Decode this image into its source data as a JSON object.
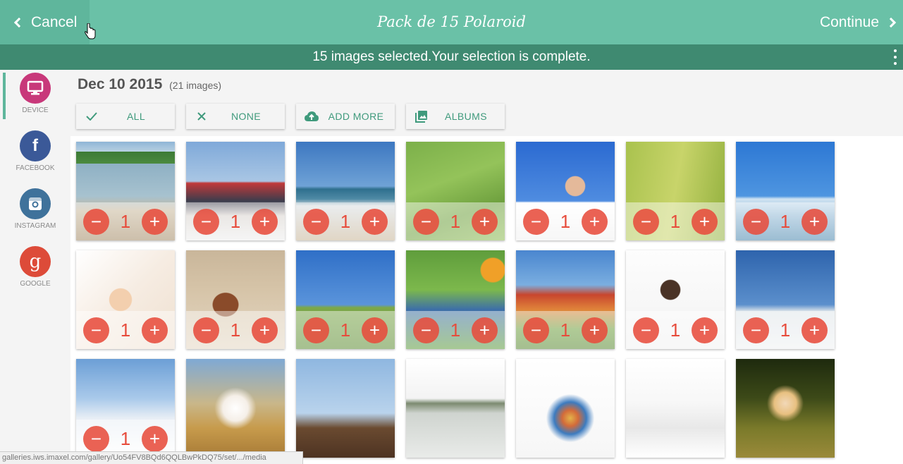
{
  "header": {
    "cancel_label": "Cancel",
    "title": "Pack de 15 Polaroid",
    "continue_label": "Continue"
  },
  "status": {
    "message": "15 images selected.Your selection is complete."
  },
  "sidebar": {
    "items": [
      {
        "label": "DEVICE",
        "icon": "monitor-icon",
        "color": "#c8387a",
        "active": true
      },
      {
        "label": "FACEBOOK",
        "icon": "facebook-icon",
        "color": "#3b5998",
        "active": false
      },
      {
        "label": "INSTAGRAM",
        "icon": "instagram-icon",
        "color": "#3f729b",
        "active": false
      },
      {
        "label": "GOOGLE",
        "icon": "google-icon",
        "color": "#dd4b39",
        "active": false
      }
    ]
  },
  "album": {
    "date": "Dec 10 2015",
    "count_text": "(21 images)"
  },
  "actions": {
    "all": "ALL",
    "none": "NONE",
    "add_more": "ADD MORE",
    "albums": "ALBUMS"
  },
  "photos": [
    {
      "count": "1"
    },
    {
      "count": "1"
    },
    {
      "count": "1"
    },
    {
      "count": "1"
    },
    {
      "count": "1"
    },
    {
      "count": "1"
    },
    {
      "count": "1"
    },
    {
      "count": "1"
    },
    {
      "count": "1"
    },
    {
      "count": "1"
    },
    {
      "count": "1"
    },
    {
      "count": "1"
    },
    {
      "count": "1"
    },
    {
      "count": "1"
    },
    {
      "count": "1"
    }
  ],
  "colors": {
    "topbar": "#6ac1a7",
    "statusbar": "#3f8a71",
    "accent": "#3f9a7c",
    "remove": "#e74c3c"
  },
  "statusbar_url": "galleries.iws.imaxel.com/gallery/Uo54FV8BQd6QQLBwPkDQ75/set/.../media"
}
